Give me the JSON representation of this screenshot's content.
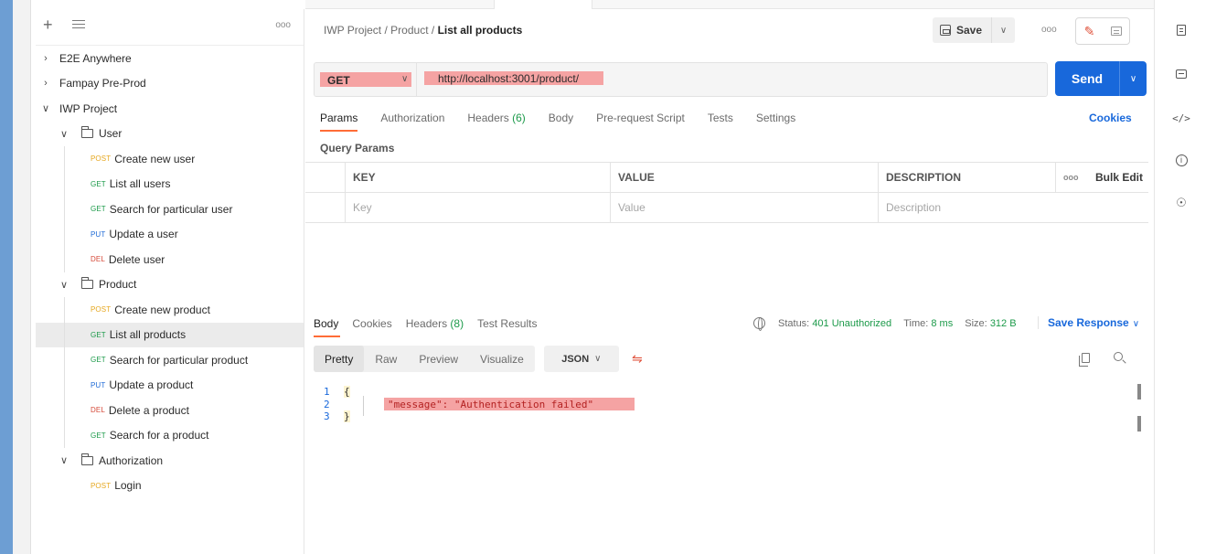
{
  "sidebar": {
    "rows": [
      {
        "type": "collection",
        "chevron": ">",
        "label": "E2E Anywhere"
      },
      {
        "type": "collection",
        "chevron": ">",
        "label": "Fampay Pre-Prod"
      },
      {
        "type": "collection",
        "chevron": "v",
        "label": "IWP Project"
      },
      {
        "type": "folder",
        "chevron": "v",
        "label": "User"
      },
      {
        "type": "request",
        "method": "POST",
        "label": "Create new user"
      },
      {
        "type": "request",
        "method": "GET",
        "label": "List all users"
      },
      {
        "type": "request",
        "method": "GET",
        "label": "Search for particular user"
      },
      {
        "type": "request",
        "method": "PUT",
        "label": "Update a user"
      },
      {
        "type": "request",
        "method": "DEL",
        "label": "Delete user"
      },
      {
        "type": "folder",
        "chevron": "v",
        "label": "Product"
      },
      {
        "type": "request",
        "method": "POST",
        "label": "Create new product"
      },
      {
        "type": "request",
        "method": "GET",
        "label": "List all products",
        "selected": true
      },
      {
        "type": "request",
        "method": "GET",
        "label": "Search for particular product"
      },
      {
        "type": "request",
        "method": "PUT",
        "label": "Update a product"
      },
      {
        "type": "request",
        "method": "DEL",
        "label": "Delete a product"
      },
      {
        "type": "request",
        "method": "GET",
        "label": "Search for a product"
      },
      {
        "type": "folder",
        "chevron": "v",
        "label": "Authorization"
      },
      {
        "type": "request",
        "method": "POST",
        "label": "Login"
      }
    ]
  },
  "header": {
    "breadcrumb_parent": "IWP Project",
    "breadcrumb_folder": "Product",
    "breadcrumb_sep": "/",
    "breadcrumb_current": "List all products",
    "save_label": "Save"
  },
  "request": {
    "method": "GET",
    "url": "http://localhost:3001/product/",
    "send_label": "Send",
    "tabs": [
      "Params",
      "Authorization",
      "Headers",
      "Body",
      "Pre-request Script",
      "Tests",
      "Settings"
    ],
    "headers_count": "(6)",
    "cookies_label": "Cookies",
    "query_params_title": "Query Params",
    "table_headers": [
      "KEY",
      "VALUE",
      "DESCRIPTION"
    ],
    "bulk_edit_label": "Bulk Edit",
    "placeholders": [
      "Key",
      "Value",
      "Description"
    ]
  },
  "response": {
    "tabs": [
      "Body",
      "Cookies",
      "Headers",
      "Test Results"
    ],
    "headers_count": "(8)",
    "status_label": "Status:",
    "status_value": "401 Unauthorized",
    "time_label": "Time:",
    "time_value": "8 ms",
    "size_label": "Size:",
    "size_value": "312 B",
    "save_response_label": "Save Response",
    "view_tabs": [
      "Pretty",
      "Raw",
      "Preview",
      "Visualize"
    ],
    "format": "JSON",
    "lines": [
      {
        "n": "1",
        "text": "{"
      },
      {
        "n": "2",
        "text": "\"message\": \"Authentication failed\""
      },
      {
        "n": "3",
        "text": "}"
      }
    ]
  },
  "colors": {
    "accent": "#ff6c37",
    "primary": "#1868db",
    "get": "#1c9a4a",
    "post": "#e6a71e",
    "put": "#1f6ad6",
    "del": "#d64b3a"
  }
}
